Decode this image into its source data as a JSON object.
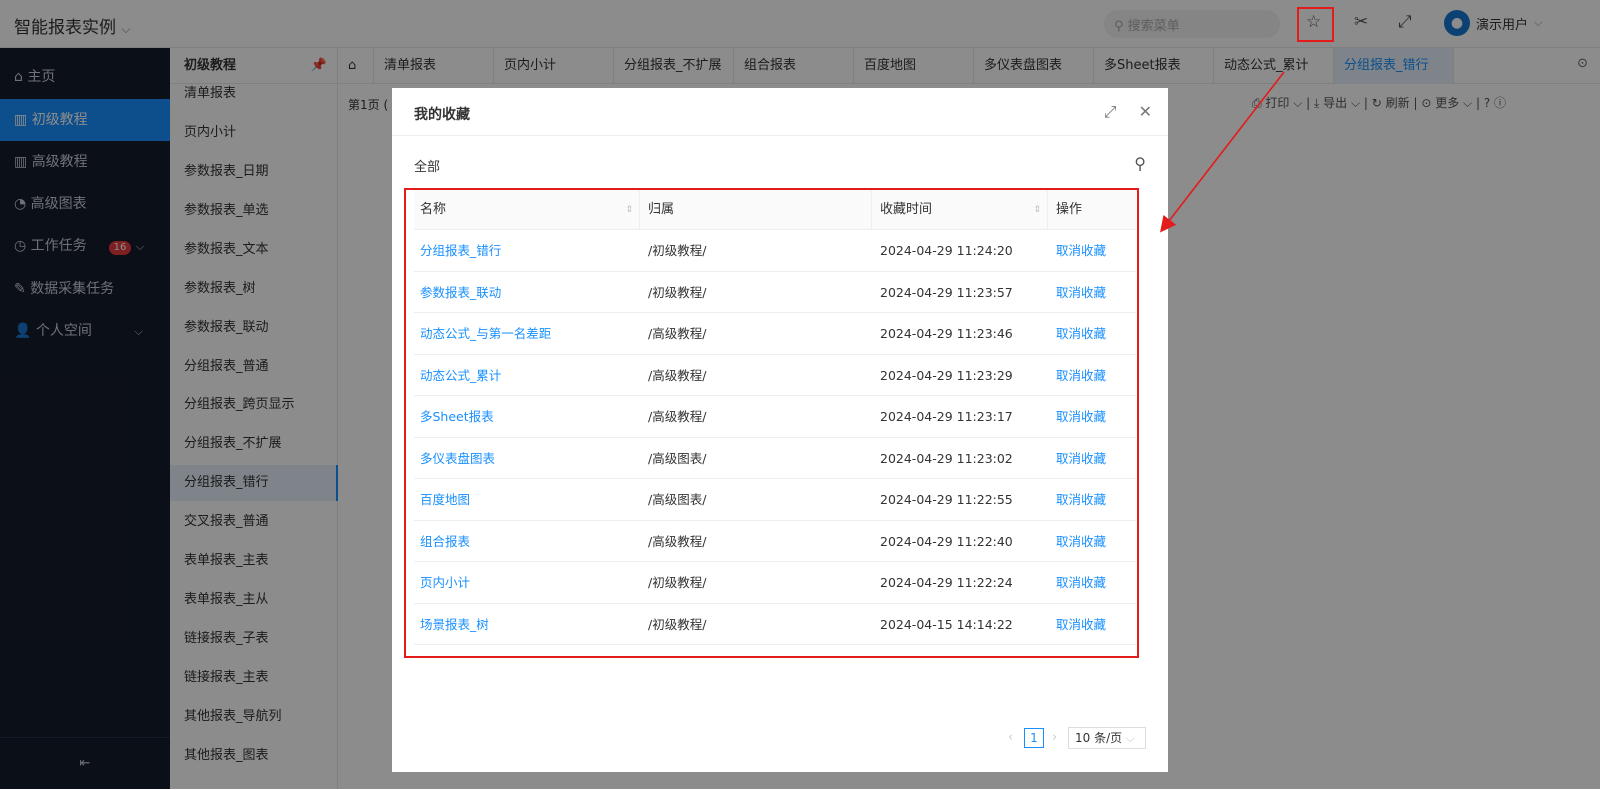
{
  "app": {
    "title": "智能报表实例",
    "search_placeholder": "搜索菜单",
    "user": "演示用户"
  },
  "nav": {
    "items": [
      {
        "label": "主页",
        "icon": "home-icon"
      },
      {
        "label": "初级教程",
        "icon": "book-icon"
      },
      {
        "label": "高级教程",
        "icon": "book-icon"
      },
      {
        "label": "高级图表",
        "icon": "chart-icon"
      },
      {
        "label": "工作任务",
        "icon": "clock-icon",
        "badge": "16"
      },
      {
        "label": "数据采集任务",
        "icon": "edit-icon"
      },
      {
        "label": "个人空间",
        "icon": "user-icon"
      }
    ]
  },
  "sub": {
    "title": "初级教程",
    "items": [
      "清单报表",
      "页内小计",
      "参数报表_日期",
      "参数报表_单选",
      "参数报表_文本",
      "参数报表_树",
      "参数报表_联动",
      "分组报表_普通",
      "分组报表_跨页显示",
      "分组报表_不扩展",
      "分组报表_错行",
      "交叉报表_普通",
      "表单报表_主表",
      "表单报表_主从",
      "链接报表_子表",
      "链接报表_主表",
      "其他报表_导航列",
      "其他报表_图表"
    ],
    "active": "分组报表_错行"
  },
  "tabs": [
    "清单报表",
    "页内小计",
    "分组报表_不扩展",
    "组合报表",
    "百度地图",
    "多仪表盘图表",
    "多Sheet报表",
    "动态公式_累计",
    "分组报表_错行"
  ],
  "main": {
    "page_label": "第1页 (",
    "toolbar": {
      "print": "打印",
      "export": "导出",
      "refresh": "刷新",
      "more": "更多"
    }
  },
  "modal": {
    "title": "我的收藏",
    "filter": "全部",
    "columns": [
      "名称",
      "归属",
      "收藏时间",
      "操作"
    ],
    "rows": [
      {
        "name": "分组报表_错行",
        "path": "/初级教程/",
        "time": "2024-04-29 11:24:20",
        "action": "取消收藏"
      },
      {
        "name": "参数报表_联动",
        "path": "/初级教程/",
        "time": "2024-04-29 11:23:57",
        "action": "取消收藏"
      },
      {
        "name": "动态公式_与第一名差距",
        "path": "/高级教程/",
        "time": "2024-04-29 11:23:46",
        "action": "取消收藏"
      },
      {
        "name": "动态公式_累计",
        "path": "/高级教程/",
        "time": "2024-04-29 11:23:29",
        "action": "取消收藏"
      },
      {
        "name": "多Sheet报表",
        "path": "/高级教程/",
        "time": "2024-04-29 11:23:17",
        "action": "取消收藏"
      },
      {
        "name": "多仪表盘图表",
        "path": "/高级图表/",
        "time": "2024-04-29 11:23:02",
        "action": "取消收藏"
      },
      {
        "name": "百度地图",
        "path": "/高级图表/",
        "time": "2024-04-29 11:22:55",
        "action": "取消收藏"
      },
      {
        "name": "组合报表",
        "path": "/高级教程/",
        "time": "2024-04-29 11:22:40",
        "action": "取消收藏"
      },
      {
        "name": "页内小计",
        "path": "/初级教程/",
        "time": "2024-04-29 11:22:24",
        "action": "取消收藏"
      },
      {
        "name": "场景报表_树",
        "path": "/初级教程/",
        "time": "2024-04-15 14:14:22",
        "action": "取消收藏"
      }
    ],
    "pagination": {
      "current": "1",
      "page_size": "10 条/页"
    }
  },
  "colors": {
    "accent": "#1890ff",
    "annotation": "#e31b1b"
  }
}
